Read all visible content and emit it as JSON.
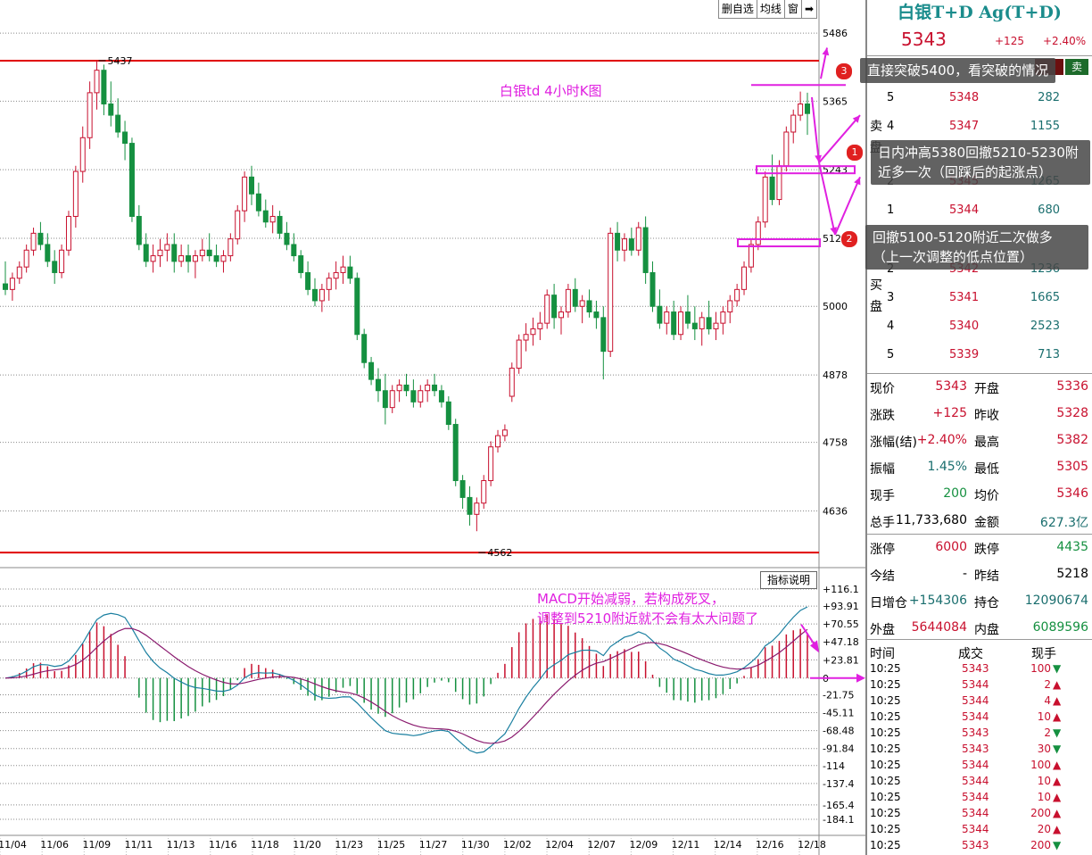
{
  "toolbar": {
    "items": [
      "删自选",
      "均线",
      "窗"
    ]
  },
  "chart_title": "白银td 4小时K图",
  "macd_note_line1": "MACD开始减弱，若构成死叉，",
  "macd_note_line2": "调整到5210附近就不会有太大问题了",
  "indicator_button": "指标说明",
  "notes": [
    {
      "num": "3",
      "text": "直接突破5400，看突破的情况"
    },
    {
      "num": "1",
      "line1": "日内冲高5380回撤5210-5230附",
      "line2": "近多一次（回踩后的起涨点）"
    },
    {
      "num": "2",
      "line1": "回撤5100-5120附近二次做多",
      "line2": "（上一次调整的低点位置）"
    }
  ],
  "chart_data": [
    {
      "type": "candlestick",
      "title": "白银td 4小时K图",
      "y_ticks": [
        5486,
        5365,
        5243,
        5121,
        5000,
        4878,
        4758,
        4636
      ],
      "ylim": [
        4540,
        5510
      ],
      "x_ticks": [
        "11/04",
        "11/06",
        "11/09",
        "11/11",
        "11/13",
        "11/16",
        "11/18",
        "11/20",
        "11/23",
        "11/25",
        "11/27",
        "11/30",
        "12/02",
        "12/04",
        "12/07",
        "12/09",
        "12/11",
        "12/14",
        "12/16",
        "12/18"
      ],
      "annotations": [
        {
          "label": "5437",
          "value": 5437
        },
        {
          "label": "4562",
          "value": 4562
        }
      ],
      "horizontal_lines": [
        5437,
        4562
      ],
      "candles": [
        [
          5040,
          5080,
          5020,
          5030
        ],
        [
          5030,
          5060,
          5010,
          5050
        ],
        [
          5050,
          5080,
          5040,
          5070
        ],
        [
          5070,
          5110,
          5060,
          5100
        ],
        [
          5100,
          5140,
          5090,
          5130
        ],
        [
          5130,
          5150,
          5100,
          5110
        ],
        [
          5110,
          5130,
          5070,
          5080
        ],
        [
          5080,
          5100,
          5040,
          5060
        ],
        [
          5060,
          5110,
          5050,
          5100
        ],
        [
          5100,
          5170,
          5090,
          5160
        ],
        [
          5160,
          5250,
          5140,
          5240
        ],
        [
          5240,
          5320,
          5220,
          5300
        ],
        [
          5300,
          5400,
          5280,
          5380
        ],
        [
          5380,
          5437,
          5350,
          5420
        ],
        [
          5420,
          5430,
          5340,
          5360
        ],
        [
          5360,
          5400,
          5320,
          5340
        ],
        [
          5340,
          5370,
          5300,
          5310
        ],
        [
          5310,
          5330,
          5260,
          5290
        ],
        [
          5290,
          5300,
          5150,
          5160
        ],
        [
          5160,
          5180,
          5100,
          5110
        ],
        [
          5110,
          5130,
          5070,
          5080
        ],
        [
          5080,
          5110,
          5060,
          5090
        ],
        [
          5090,
          5120,
          5070,
          5100
        ],
        [
          5100,
          5130,
          5080,
          5110
        ],
        [
          5110,
          5130,
          5060,
          5080
        ],
        [
          5080,
          5110,
          5070,
          5090
        ],
        [
          5090,
          5110,
          5060,
          5080
        ],
        [
          5080,
          5100,
          5050,
          5090
        ],
        [
          5090,
          5120,
          5080,
          5100
        ],
        [
          5100,
          5130,
          5080,
          5090
        ],
        [
          5090,
          5110,
          5070,
          5080
        ],
        [
          5080,
          5100,
          5060,
          5090
        ],
        [
          5090,
          5130,
          5080,
          5120
        ],
        [
          5120,
          5180,
          5110,
          5170
        ],
        [
          5170,
          5240,
          5150,
          5230
        ],
        [
          5230,
          5250,
          5180,
          5200
        ],
        [
          5200,
          5220,
          5160,
          5170
        ],
        [
          5170,
          5190,
          5140,
          5150
        ],
        [
          5150,
          5180,
          5130,
          5160
        ],
        [
          5160,
          5170,
          5120,
          5130
        ],
        [
          5130,
          5150,
          5100,
          5110
        ],
        [
          5110,
          5130,
          5080,
          5090
        ],
        [
          5090,
          5100,
          5050,
          5060
        ],
        [
          5060,
          5080,
          5020,
          5030
        ],
        [
          5030,
          5050,
          5000,
          5010
        ],
        [
          5010,
          5040,
          4990,
          5030
        ],
        [
          5030,
          5060,
          5010,
          5050
        ],
        [
          5050,
          5080,
          5030,
          5060
        ],
        [
          5060,
          5090,
          5040,
          5070
        ],
        [
          5070,
          5090,
          5040,
          5050
        ],
        [
          5050,
          5060,
          4940,
          4950
        ],
        [
          4950,
          4960,
          4890,
          4900
        ],
        [
          4900,
          4910,
          4860,
          4870
        ],
        [
          4870,
          4890,
          4830,
          4850
        ],
        [
          4850,
          4880,
          4790,
          4820
        ],
        [
          4820,
          4860,
          4810,
          4850
        ],
        [
          4850,
          4870,
          4830,
          4860
        ],
        [
          4860,
          4880,
          4840,
          4850
        ],
        [
          4850,
          4870,
          4820,
          4830
        ],
        [
          4830,
          4860,
          4820,
          4850
        ],
        [
          4850,
          4870,
          4830,
          4860
        ],
        [
          4860,
          4880,
          4840,
          4850
        ],
        [
          4850,
          4860,
          4820,
          4830
        ],
        [
          4830,
          4840,
          4780,
          4790
        ],
        [
          4790,
          4800,
          4680,
          4690
        ],
        [
          4690,
          4700,
          4640,
          4660
        ],
        [
          4660,
          4680,
          4610,
          4630
        ],
        [
          4630,
          4660,
          4600,
          4650
        ],
        [
          4650,
          4700,
          4640,
          4690
        ],
        [
          4690,
          4760,
          4680,
          4750
        ],
        [
          4750,
          4780,
          4740,
          4770
        ],
        [
          4770,
          4790,
          4760,
          4780
        ],
        [
          4840,
          4900,
          4830,
          4890
        ],
        [
          4890,
          4950,
          4880,
          4940
        ],
        [
          4940,
          4970,
          4920,
          4950
        ],
        [
          4950,
          4980,
          4930,
          4960
        ],
        [
          4960,
          4990,
          4940,
          4970
        ],
        [
          4970,
          5030,
          4960,
          5020
        ],
        [
          5020,
          5040,
          4960,
          4980
        ],
        [
          4980,
          5000,
          4950,
          4990
        ],
        [
          4990,
          5040,
          4980,
          5030
        ],
        [
          5030,
          5050,
          4990,
          5000
        ],
        [
          5000,
          5020,
          4970,
          5010
        ],
        [
          5010,
          5030,
          4980,
          4990
        ],
        [
          4990,
          5010,
          4960,
          4980
        ],
        [
          4980,
          5000,
          4870,
          4920
        ],
        [
          4920,
          5140,
          4910,
          5130
        ],
        [
          5130,
          5150,
          5080,
          5100
        ],
        [
          5100,
          5130,
          5080,
          5120
        ],
        [
          5120,
          5140,
          5090,
          5100
        ],
        [
          5100,
          5150,
          5090,
          5140
        ],
        [
          5140,
          5160,
          5040,
          5060
        ],
        [
          5060,
          5080,
          4990,
          5000
        ],
        [
          5000,
          5030,
          4960,
          4970
        ],
        [
          4970,
          5000,
          4950,
          4990
        ],
        [
          4990,
          5010,
          4940,
          4950
        ],
        [
          4950,
          5000,
          4940,
          4990
        ],
        [
          4990,
          5020,
          4960,
          4970
        ],
        [
          4970,
          5000,
          4940,
          4960
        ],
        [
          4960,
          4990,
          4930,
          4980
        ],
        [
          4980,
          5010,
          4950,
          4960
        ],
        [
          4960,
          4990,
          4940,
          4970
        ],
        [
          4970,
          5000,
          4950,
          4990
        ],
        [
          4990,
          5020,
          4970,
          5010
        ],
        [
          5010,
          5040,
          5000,
          5030
        ],
        [
          5030,
          5080,
          5020,
          5070
        ],
        [
          5070,
          5120,
          5060,
          5110
        ],
        [
          5110,
          5160,
          5100,
          5150
        ],
        [
          5150,
          5240,
          5140,
          5230
        ],
        [
          5230,
          5270,
          5180,
          5190
        ],
        [
          5190,
          5260,
          5180,
          5250
        ],
        [
          5250,
          5320,
          5240,
          5310
        ],
        [
          5310,
          5350,
          5290,
          5340
        ],
        [
          5340,
          5382,
          5330,
          5360
        ],
        [
          5360,
          5380,
          5305,
          5343
        ]
      ]
    },
    {
      "type": "macd",
      "y_ticks": [
        116.1,
        93.91,
        70.55,
        47.18,
        23.81,
        0,
        -21.75,
        -45.11,
        -68.48,
        -91.84,
        -114.0,
        -137.4,
        -165.4,
        -184.1
      ],
      "ylim": [
        -184.1,
        116.1
      ]
    }
  ],
  "right_panel": {
    "title": "白银T+D Ag(T+D)",
    "price": "5343",
    "change": "+125",
    "change_pct": "+2.40%",
    "sell_label": "卖",
    "side_sell": "卖盘",
    "side_buy": "买盘",
    "asks": [
      {
        "level": "5",
        "price": "5348",
        "vol": "282"
      },
      {
        "level": "4",
        "price": "5347",
        "vol": "1155"
      },
      {
        "level": "2",
        "price": "5345",
        "vol": "1265"
      },
      {
        "level": "1",
        "price": "5344",
        "vol": "680"
      }
    ],
    "bids": [
      {
        "level": "2",
        "price": "5342",
        "vol": "1236"
      },
      {
        "level": "3",
        "price": "5341",
        "vol": "1665"
      },
      {
        "level": "4",
        "price": "5340",
        "vol": "2523"
      },
      {
        "level": "5",
        "price": "5339",
        "vol": "713"
      }
    ],
    "quote": [
      {
        "l1": "现价",
        "v1": "5343",
        "c1": "red",
        "l2": "开盘",
        "v2": "5336",
        "c2": "red"
      },
      {
        "l1": "涨跌",
        "v1": "+125",
        "c1": "red",
        "l2": "昨收",
        "v2": "5328",
        "c2": "red"
      },
      {
        "l1": "涨幅(结)",
        "v1": "+2.40%",
        "c1": "red",
        "l2": "最高",
        "v2": "5382",
        "c2": "red"
      },
      {
        "l1": "振幅",
        "v1": "1.45%",
        "c1": "teal",
        "l2": "最低",
        "v2": "5305",
        "c2": "red"
      },
      {
        "l1": "现手",
        "v1": "200",
        "c1": "green",
        "l2": "均价",
        "v2": "5346",
        "c2": "red"
      },
      {
        "l1": "总手",
        "v1": "11,733,680",
        "c1": "black",
        "l2": "金额",
        "v2": "627.3亿",
        "c2": "teal"
      }
    ],
    "quote2": [
      {
        "l1": "涨停",
        "v1": "6000",
        "c1": "red",
        "l2": "跌停",
        "v2": "4435",
        "c2": "green"
      },
      {
        "l1": "今结",
        "v1": "-",
        "c1": "black",
        "l2": "昨结",
        "v2": "5218",
        "c2": "black"
      },
      {
        "l1": "日增仓",
        "v1": "+154306",
        "c1": "teal",
        "l2": "持仓",
        "v2": "12090674",
        "c2": "teal"
      },
      {
        "l1": "外盘",
        "v1": "5644084",
        "c1": "red",
        "l2": "内盘",
        "v2": "6089596",
        "c2": "green"
      }
    ],
    "trades_header": {
      "time": "时间",
      "price": "成交",
      "vol": "现手"
    },
    "trades": [
      {
        "time": "10:25",
        "price": "5343",
        "vol": "100",
        "dir": "down"
      },
      {
        "time": "10:25",
        "price": "5344",
        "vol": "2",
        "dir": "up"
      },
      {
        "time": "10:25",
        "price": "5344",
        "vol": "4",
        "dir": "up"
      },
      {
        "time": "10:25",
        "price": "5344",
        "vol": "10",
        "dir": "up"
      },
      {
        "time": "10:25",
        "price": "5343",
        "vol": "2",
        "dir": "down"
      },
      {
        "time": "10:25",
        "price": "5343",
        "vol": "30",
        "dir": "down"
      },
      {
        "time": "10:25",
        "price": "5344",
        "vol": "100",
        "dir": "up"
      },
      {
        "time": "10:25",
        "price": "5344",
        "vol": "10",
        "dir": "up"
      },
      {
        "time": "10:25",
        "price": "5344",
        "vol": "10",
        "dir": "up"
      },
      {
        "time": "10:25",
        "price": "5344",
        "vol": "200",
        "dir": "up"
      },
      {
        "time": "10:25",
        "price": "5344",
        "vol": "20",
        "dir": "up"
      },
      {
        "time": "10:25",
        "price": "5343",
        "vol": "200",
        "dir": "down"
      }
    ]
  },
  "colors": {
    "up": "#c8102e",
    "down": "#159040",
    "accent": "#e020e0",
    "teal": "#1a6e6e"
  }
}
